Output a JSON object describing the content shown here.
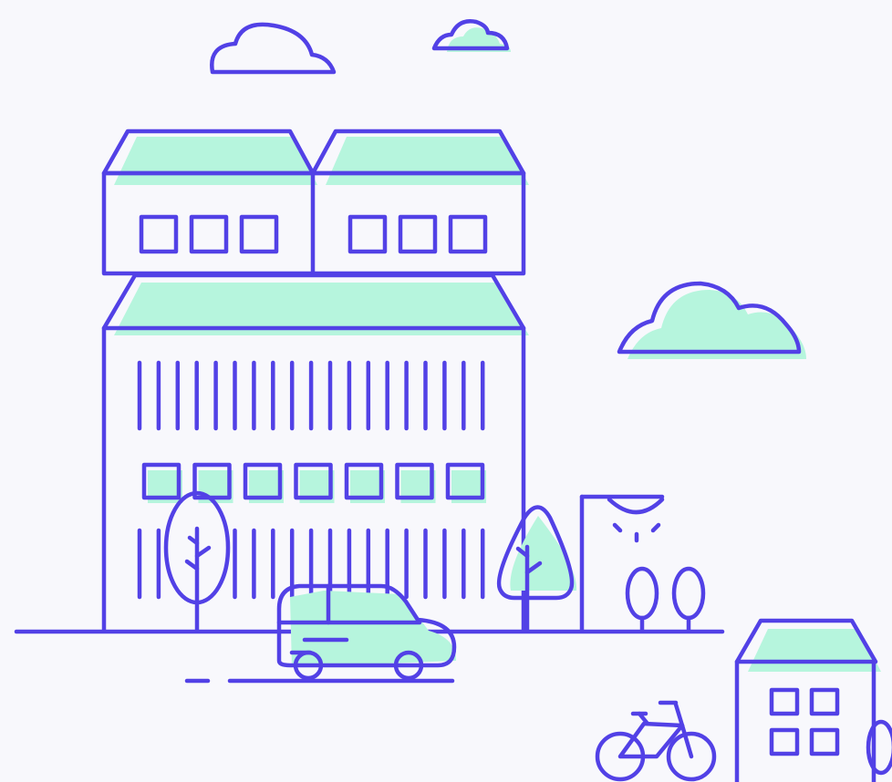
{
  "illustration": {
    "theme": "city-street-line-art",
    "stroke_color": "#5241e6",
    "fill_color": "#b6f5dd",
    "background_color": "#f8f8fc"
  }
}
